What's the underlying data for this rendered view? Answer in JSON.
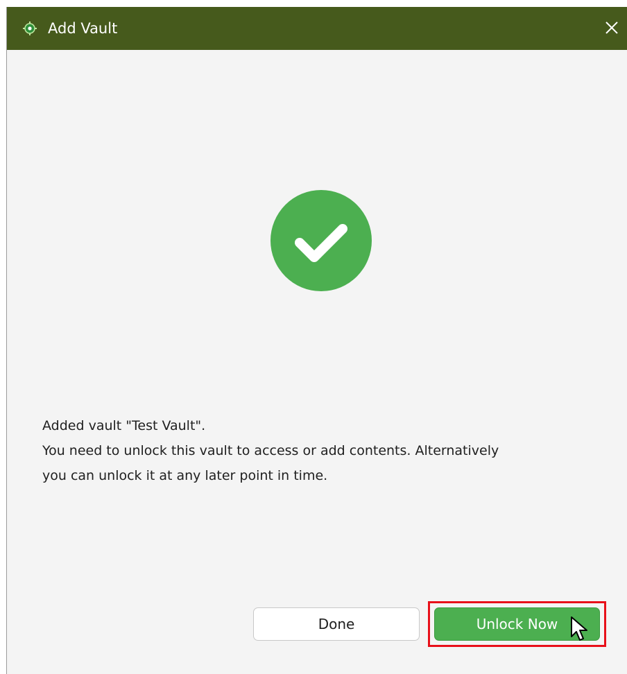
{
  "window": {
    "title": "Add Vault",
    "app_icon": "vault-app-icon",
    "close_icon": "close-icon"
  },
  "status": {
    "icon": "checkmark-circle-icon",
    "color": "#4caf50"
  },
  "message": {
    "line1": "Added vault \"Test Vault\".",
    "line2": "You need to unlock this vault to access or add contents. Alternatively",
    "line3": "you can unlock it at any later point in time."
  },
  "buttons": {
    "done_label": "Done",
    "unlock_label": "Unlock Now"
  },
  "colors": {
    "titlebar": "#465a1c",
    "accent": "#4caf50",
    "highlight": "#e8101a"
  }
}
